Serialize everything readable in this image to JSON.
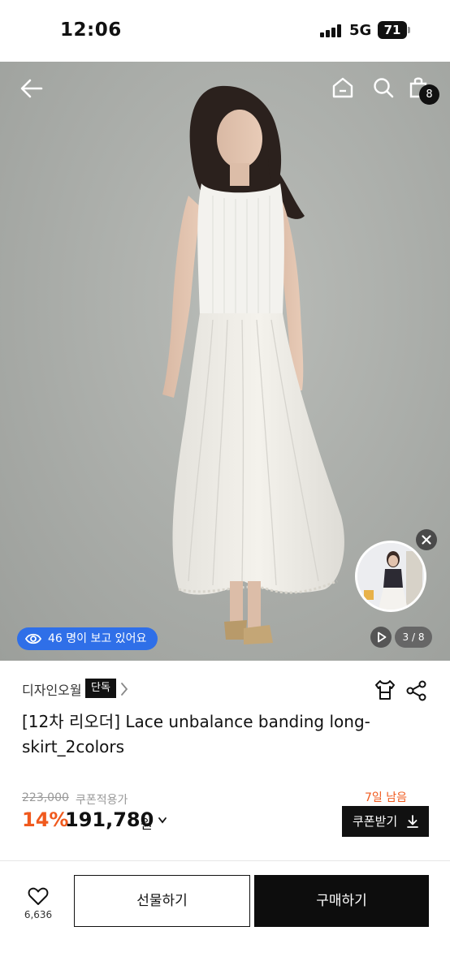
{
  "status_bar": {
    "time": "12:06",
    "network": "5G",
    "battery": "71"
  },
  "header": {
    "cart_count": "8"
  },
  "hero": {
    "viewers_text": "46 명이 보고 있어요",
    "page_indicator": "3 / 8"
  },
  "product": {
    "brand": "디자인오월",
    "exclusive_badge": "단독",
    "title": "[12차 리오더] Lace unbalance banding long-skirt_2colors",
    "original_price": "223,000",
    "coupon_applied": "쿠폰적용가",
    "discount": "14%",
    "sale_price": "191,780",
    "currency": "원",
    "days_left": "7일 남음",
    "coupon_button": "쿠폰받기"
  },
  "bottom_bar": {
    "like_count": "6,636",
    "gift_button": "선물하기",
    "buy_button": "구매하기"
  },
  "colors": {
    "accent_orange": "#f05a1e",
    "viewer_blue": "#2f6fe8",
    "dark": "#111111"
  },
  "icons": [
    "back-arrow-icon",
    "home-icon",
    "search-icon",
    "shopping-bag-icon",
    "eye-icon",
    "close-icon",
    "play-icon",
    "chevron-right-icon",
    "hanger-icon",
    "share-icon",
    "chevron-down-icon",
    "download-icon",
    "heart-icon"
  ]
}
